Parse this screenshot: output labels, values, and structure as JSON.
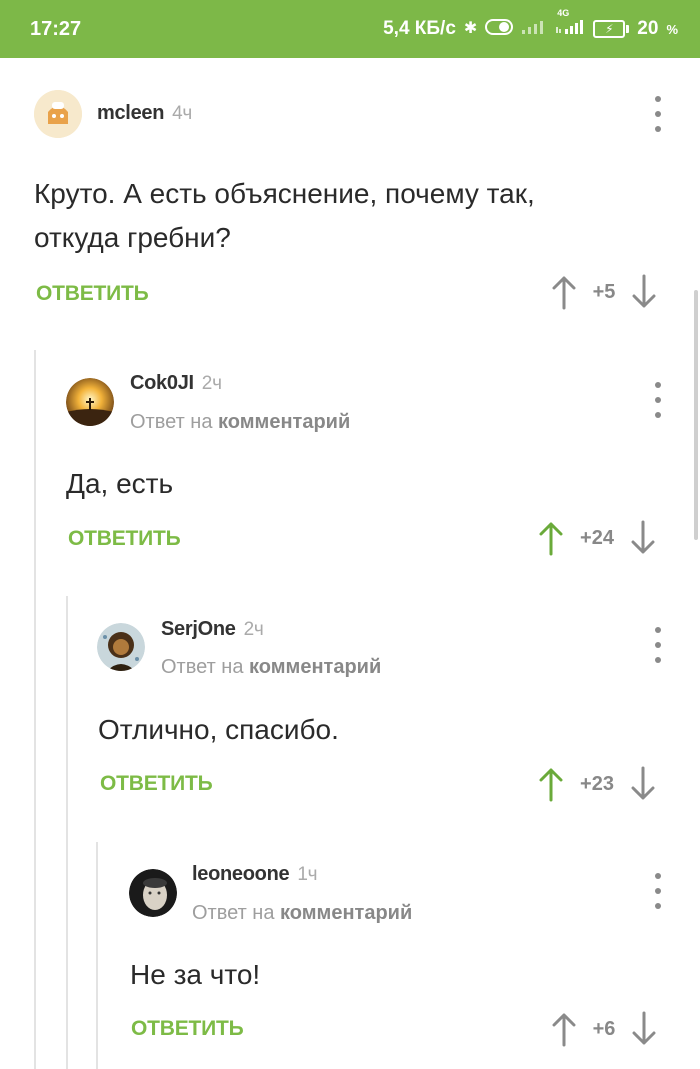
{
  "status_bar": {
    "time": "17:27",
    "speed": "5,4 КБ/с",
    "network": "4G",
    "battery": "20",
    "battery_unit": "%",
    "bluetooth_icon": "bluetooth-icon",
    "signal_icon": "signal-icon"
  },
  "colors": {
    "accent": "#7db848",
    "reply_green": "#7dbb46",
    "upvoted_green": "#6aaa3a",
    "neutral_arrow": "#8a8a8a"
  },
  "comments": [
    {
      "username": "mcleen",
      "time": "4ч",
      "reply_prefix": "",
      "reply_target": "",
      "lines": [
        "Круто. А есть объяснение, почему так,",
        "откуда гребни?"
      ],
      "reply_label": "ОТВЕТИТЬ",
      "score": "+5",
      "upvoted": false
    },
    {
      "username": "Cok0JI",
      "time": "2ч",
      "reply_prefix": "Ответ на",
      "reply_target": "комментарий",
      "lines": [
        "Да, есть"
      ],
      "reply_label": "ОТВЕТИТЬ",
      "score": "+24",
      "upvoted": true
    },
    {
      "username": "SerjOne",
      "time": "2ч",
      "reply_prefix": "Ответ на",
      "reply_target": "комментарий",
      "lines": [
        "Отлично, спасибо."
      ],
      "reply_label": "ОТВЕТИТЬ",
      "score": "+23",
      "upvoted": true
    },
    {
      "username": "leoneoone",
      "time": "1ч",
      "reply_prefix": "Ответ на",
      "reply_target": "комментарий",
      "lines": [
        "Не за что!"
      ],
      "reply_label": "ОТВЕТИТЬ",
      "score": "+6",
      "upvoted": false
    }
  ]
}
